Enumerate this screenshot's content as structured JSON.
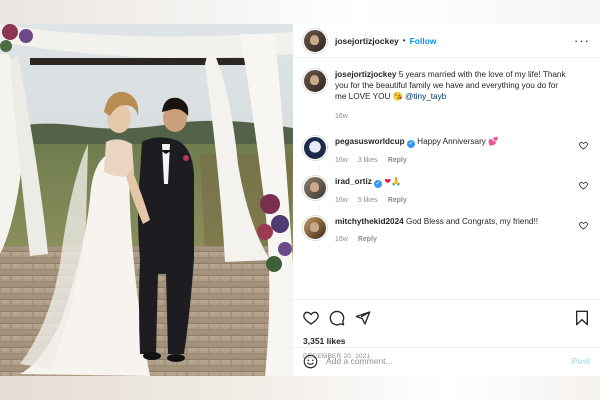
{
  "post": {
    "username": "josejortizjockey",
    "follow_label": "Follow",
    "more_label": "···",
    "caption": {
      "username": "josejortizjockey",
      "text": "5 years married with the love of my life! Thank you for the beautiful family we have and everything you do for me LOVE YOU",
      "emoji": "😘",
      "mention": "@tiny_tayb",
      "time": "16w"
    },
    "comments": [
      {
        "username": "pegasusworldcup",
        "text": "Happy Anniversary",
        "emoji": "💕",
        "time": "16w",
        "likes": "3 likes",
        "reply": "Reply"
      },
      {
        "username": "irad_ortiz",
        "text": "",
        "emoji": "❤🙏",
        "time": "16w",
        "likes": "5 likes",
        "reply": "Reply"
      },
      {
        "username": "mitchythekid2024",
        "text": "God Bless and Congrats, my friend!!",
        "time": "16w",
        "reply": "Reply"
      }
    ],
    "likes": "3,351 likes",
    "date": "DECEMBER 20, 2021",
    "add_comment_placeholder": "Add a comment...",
    "post_label": "Post"
  },
  "colors": {
    "accent": "#0095f6",
    "text": "#262626",
    "muted": "#8e8e8e",
    "heart": "#ed1c3f"
  },
  "icons": [
    "heart-icon",
    "comment-icon",
    "share-icon",
    "bookmark-icon",
    "emoji-icon",
    "verified-icon",
    "more-icon"
  ]
}
